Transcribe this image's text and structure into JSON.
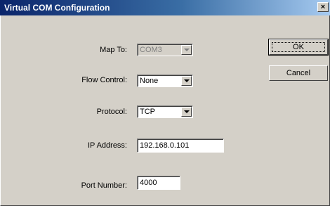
{
  "window": {
    "title": "Virtual COM Configuration",
    "close_glyph": "×"
  },
  "fields": {
    "map_to": {
      "label": "Map To:",
      "value": "COM3",
      "enabled": false
    },
    "flow_control": {
      "label": "Flow Control:",
      "value": "None"
    },
    "protocol": {
      "label": "Protocol:",
      "value": "TCP"
    },
    "ip_address": {
      "label": "IP Address:",
      "value": "192.168.0.101"
    },
    "port_number": {
      "label": "Port Number:",
      "value": "4000"
    }
  },
  "buttons": {
    "ok": "OK",
    "cancel": "Cancel"
  }
}
